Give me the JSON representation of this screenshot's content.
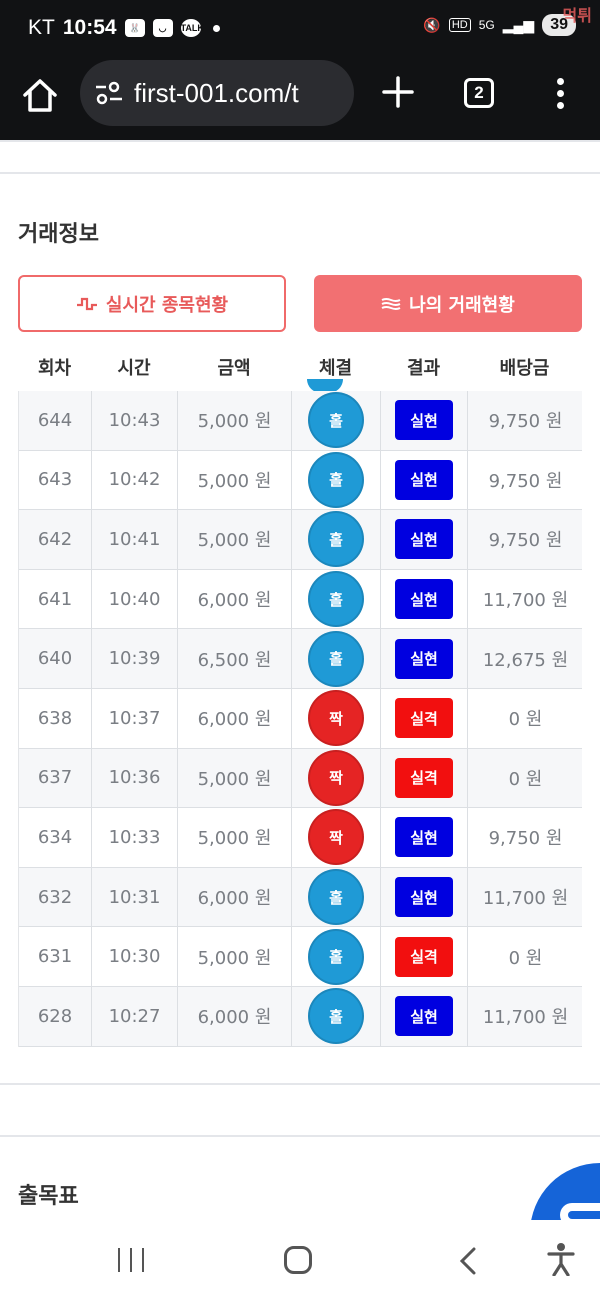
{
  "status_bar": {
    "carrier": "KT",
    "time": "10:54",
    "battery": "39",
    "network": "5G",
    "watermark": "먹튀"
  },
  "browser": {
    "url": "first-001.com/t",
    "tab_count": "2"
  },
  "trade_section": {
    "title": "거래정보",
    "live_button": "실시간 종목현황",
    "my_button": "나의 거래현황",
    "columns": [
      "회차",
      "시간",
      "금액",
      "체결",
      "결과",
      "배당금"
    ],
    "rows": [
      {
        "round": "644",
        "time": "10:43",
        "amount": "5,000 원",
        "pick": "홀",
        "pick_type": "hol",
        "result": "실현",
        "result_type": "win",
        "payout": "9,750 원"
      },
      {
        "round": "643",
        "time": "10:42",
        "amount": "5,000 원",
        "pick": "홀",
        "pick_type": "hol",
        "result": "실현",
        "result_type": "win",
        "payout": "9,750 원"
      },
      {
        "round": "642",
        "time": "10:41",
        "amount": "5,000 원",
        "pick": "홀",
        "pick_type": "hol",
        "result": "실현",
        "result_type": "win",
        "payout": "9,750 원"
      },
      {
        "round": "641",
        "time": "10:40",
        "amount": "6,000 원",
        "pick": "홀",
        "pick_type": "hol",
        "result": "실현",
        "result_type": "win",
        "payout": "11,700 원"
      },
      {
        "round": "640",
        "time": "10:39",
        "amount": "6,500 원",
        "pick": "홀",
        "pick_type": "hol",
        "result": "실현",
        "result_type": "win",
        "payout": "12,675 원"
      },
      {
        "round": "638",
        "time": "10:37",
        "amount": "6,000 원",
        "pick": "짝",
        "pick_type": "jjak",
        "result": "실격",
        "result_type": "lose",
        "payout": "0 원"
      },
      {
        "round": "637",
        "time": "10:36",
        "amount": "5,000 원",
        "pick": "짝",
        "pick_type": "jjak",
        "result": "실격",
        "result_type": "lose",
        "payout": "0 원"
      },
      {
        "round": "634",
        "time": "10:33",
        "amount": "5,000 원",
        "pick": "짝",
        "pick_type": "jjak",
        "result": "실현",
        "result_type": "win",
        "payout": "9,750 원"
      },
      {
        "round": "632",
        "time": "10:31",
        "amount": "6,000 원",
        "pick": "홀",
        "pick_type": "hol",
        "result": "실현",
        "result_type": "win",
        "payout": "11,700 원"
      },
      {
        "round": "631",
        "time": "10:30",
        "amount": "5,000 원",
        "pick": "홀",
        "pick_type": "hol",
        "result": "실격",
        "result_type": "lose",
        "payout": "0 원"
      },
      {
        "round": "628",
        "time": "10:27",
        "amount": "6,000 원",
        "pick": "홀",
        "pick_type": "hol",
        "result": "실현",
        "result_type": "win",
        "payout": "11,700 원"
      }
    ]
  },
  "draw_section": {
    "title": "출목표"
  },
  "colors": {
    "hol": "#1f9ad6",
    "jjak": "#e52424",
    "win": "#0000e0",
    "lose": "#f20f0f",
    "accent": "#f27072"
  }
}
